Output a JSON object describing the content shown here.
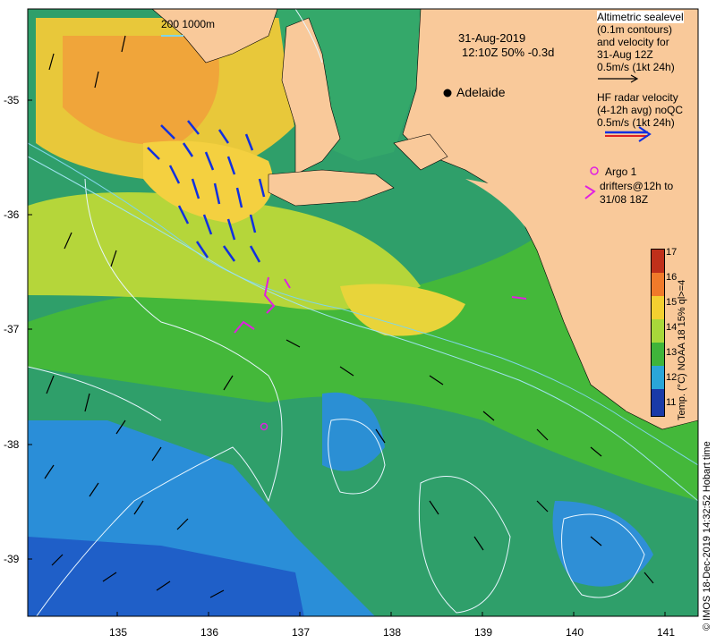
{
  "map": {
    "date": "31-Aug-2019",
    "time_info": "12:10Z  50% -0.3d",
    "city": "Adelaide",
    "bathymetry_label": "200  1000m",
    "lon_ticks": [
      "135",
      "136",
      "137",
      "138",
      "139",
      "140",
      "141"
    ],
    "lat_ticks": [
      "-35",
      "-36",
      "-37",
      "-38",
      "-39"
    ]
  },
  "legend": {
    "sealevel": [
      "Altimetric sealevel",
      "(0.1m contours)",
      "and velocity for",
      "31-Aug 12Z",
      "0.5m/s (1kt 24h)"
    ],
    "hf_radar": [
      "HF radar velocity",
      "(4-12h avg) noQC",
      "0.5m/s (1kt 24h)"
    ],
    "argo": "Argo 1",
    "drifters": [
      "drifters@12h to",
      "31/08 18Z"
    ]
  },
  "colorbar": {
    "label": "Temp. (°C) NOAA 18 15% ql>=4",
    "ticks": [
      "17",
      "16",
      "15",
      "14",
      "13",
      "12",
      "11"
    ]
  },
  "credit": "© IMOS 18-Dec-2019 14:32:52 Hobart time",
  "colors": {
    "land": "#f9c99a",
    "shelf_green": "#3fb43a",
    "deep_blue": "#1e6fd0",
    "warm_yellow": "#e8d830"
  }
}
